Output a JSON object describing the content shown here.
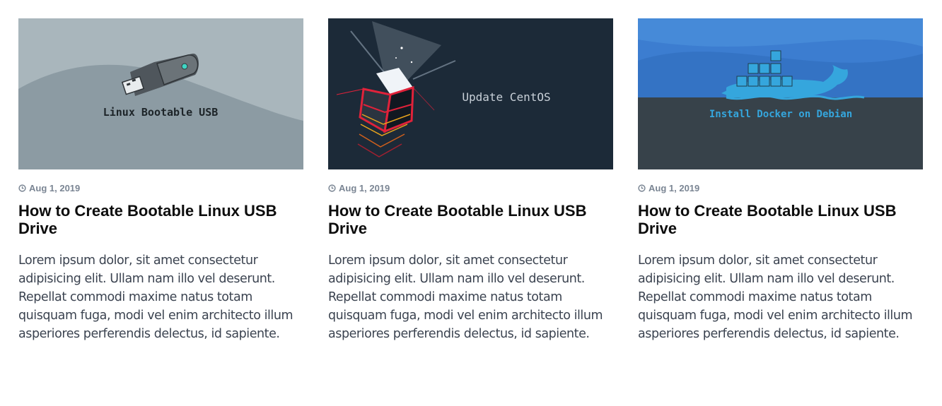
{
  "posts": [
    {
      "image": {
        "caption": "Linux Bootable USB",
        "icon": "usb-drive-icon"
      },
      "date": "Aug 1, 2019",
      "title": "How to Create Bootable Linux USB Drive",
      "excerpt": "Lorem ipsum dolor, sit amet consectetur adipisicing elit. Ullam nam illo vel deserunt. Repellat commodi maxime natus totam quisquam fuga, modi vel enim architecto illum asperiores perferendis delectus, id sapiente."
    },
    {
      "image": {
        "caption": "Update CentOS",
        "icon": "glowing-cube-icon"
      },
      "date": "Aug 1, 2019",
      "title": "How to Create Bootable Linux USB Drive",
      "excerpt": "Lorem ipsum dolor, sit amet consectetur adipisicing elit. Ullam nam illo vel deserunt. Repellat commodi maxime natus totam quisquam fuga, modi vel enim architecto illum asperiores perferendis delectus, id sapiente."
    },
    {
      "image": {
        "caption": "Install Docker on Debian",
        "icon": "docker-whale-icon"
      },
      "date": "Aug 1, 2019",
      "title": "How to Create Bootable Linux USB Drive",
      "excerpt": "Lorem ipsum dolor, sit amet consectetur adipisicing elit. Ullam nam illo vel deserunt. Repellat commodi maxime natus totam quisquam fuga, modi vel enim architecto illum asperiores perferendis delectus, id sapiente."
    }
  ],
  "colors": {
    "meta": "#7a8593",
    "title": "#0d0d0d",
    "excerpt": "#3b4350"
  }
}
